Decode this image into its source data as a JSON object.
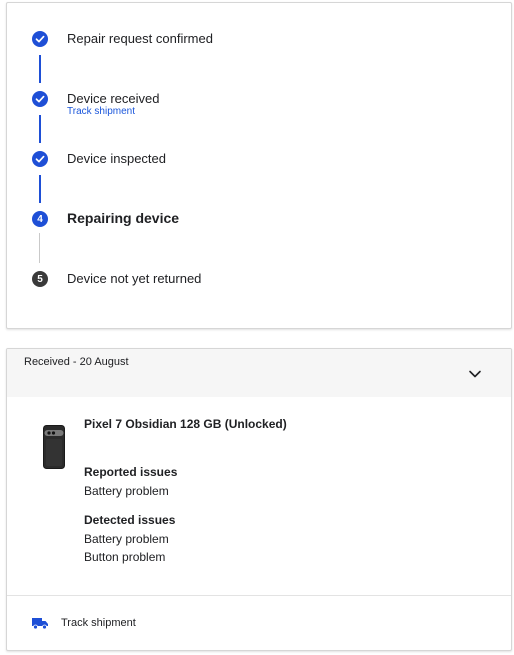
{
  "progress": {
    "steps": [
      {
        "label": "Repair request confirmed",
        "state": "done"
      },
      {
        "label": "Device received",
        "state": "done",
        "link": "Track shipment"
      },
      {
        "label": "Device inspected",
        "state": "done"
      },
      {
        "label": "Repairing device",
        "state": "active",
        "number": "4"
      },
      {
        "label": "Device not yet returned",
        "state": "pending",
        "number": "5"
      }
    ]
  },
  "order": {
    "received_label": "Received - 20 August",
    "product_title": "Pixel 7 Obsidian 128 GB (Unlocked)",
    "reported_title": "Reported issues",
    "reported_issues": [
      "Battery problem"
    ],
    "detected_title": "Detected issues",
    "detected_issues": [
      "Battery problem",
      "Button problem"
    ],
    "track_label": "Track shipment"
  },
  "colors": {
    "accent": "#1e4fd6",
    "pending": "#3a3a3a",
    "link": "#1a56db"
  },
  "icons": {
    "check": "check-icon",
    "expand": "chevron-down-icon",
    "shipping": "truck-icon",
    "product": "phone-image"
  }
}
